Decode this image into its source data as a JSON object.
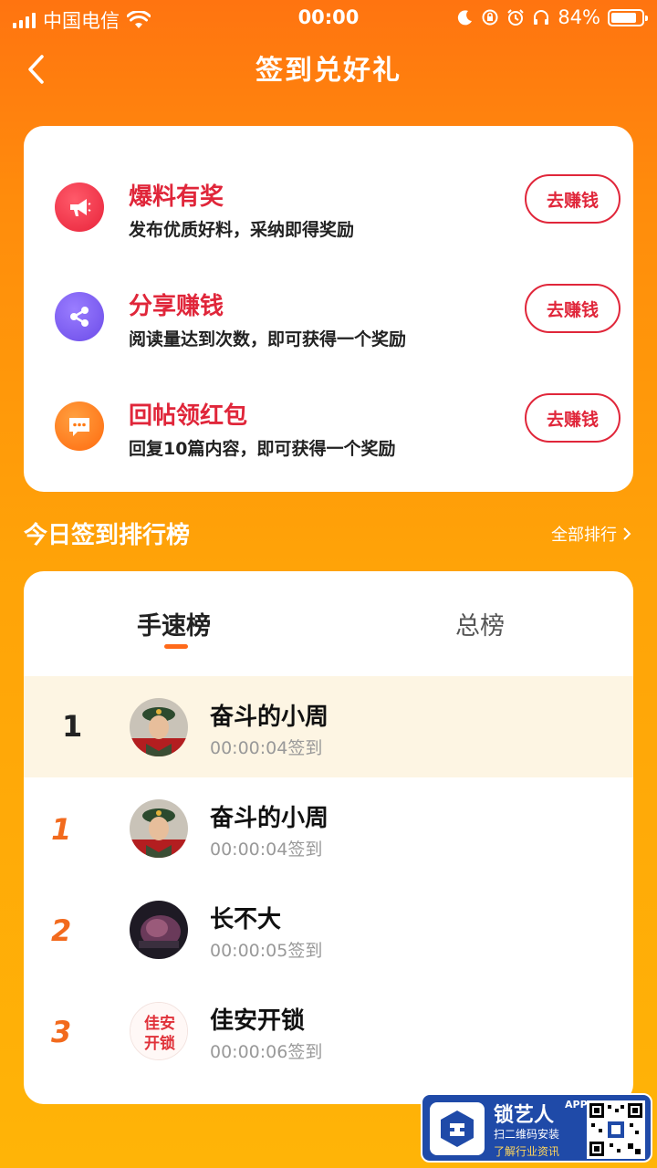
{
  "status_bar": {
    "carrier": "中国电信",
    "time": "00:00",
    "battery_percent": "84%",
    "battery_level": 0.84,
    "icons": [
      "signal-icon",
      "wifi-icon",
      "moon-icon",
      "rotation-lock-icon",
      "alarm-icon",
      "headphones-icon",
      "battery-icon"
    ]
  },
  "nav": {
    "back_icon": "chevron-left-icon",
    "title": "签到兑好礼"
  },
  "tasks": [
    {
      "title": "爆料有奖",
      "desc": "发布优质好料，采纳即得奖励",
      "button": "去赚钱",
      "icon": "megaphone-icon",
      "color": "#F2354B"
    },
    {
      "title": "分享赚钱",
      "desc": "阅读量达到次数，即可获得一个奖励",
      "button": "去赚钱",
      "icon": "share-icon",
      "color": "#7A5AF0"
    },
    {
      "title": "回帖领红包",
      "desc": "回复10篇内容，即可获得一个奖励",
      "button": "去赚钱",
      "icon": "chat-icon",
      "color": "#FF7A14"
    }
  ],
  "ranking": {
    "header": "今日签到排行榜",
    "all_link": "全部排行",
    "tabs": [
      {
        "label": "手速榜",
        "active": true
      },
      {
        "label": "总榜",
        "active": false
      }
    ],
    "my_row": {
      "rank": "1",
      "name": "奋斗的小周",
      "time": "00:00:04签到"
    },
    "rows": [
      {
        "rank": "1",
        "name": "奋斗的小周",
        "time": "00:00:04签到"
      },
      {
        "rank": "2",
        "name": "长不大",
        "time": "00:00:05签到"
      },
      {
        "rank": "3",
        "name": "佳安开锁",
        "time": "00:00:06签到"
      }
    ],
    "avatar_logo_text": [
      "佳安",
      "开锁"
    ]
  },
  "promo": {
    "name": "锁艺人",
    "badge": "APP",
    "line1": "扫二维码安装",
    "line2": "了解行业资讯"
  },
  "colors": {
    "accent_red": "#E0263A",
    "nav_orange": "#FF7410",
    "rank_orange": "#F26A1D"
  }
}
